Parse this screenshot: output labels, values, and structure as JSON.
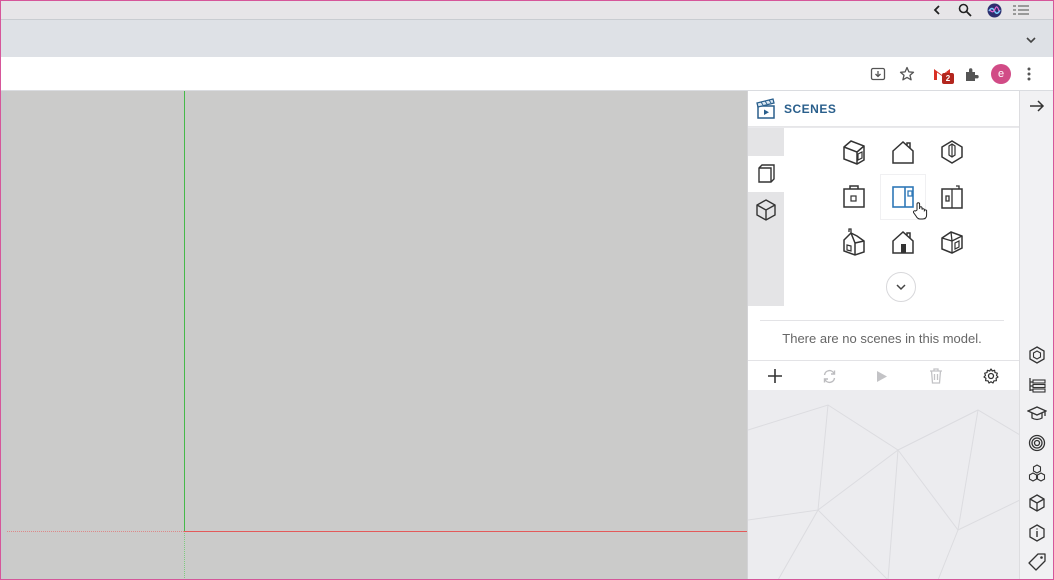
{
  "browser": {
    "toolbar_icons": [
      "install-icon",
      "star-icon",
      "gmail-icon",
      "extensions-icon",
      "kebab-menu-icon"
    ],
    "gmail_badge": "2",
    "profile_initial": "e"
  },
  "scenes_panel": {
    "title": "SCENES",
    "view_tabs": [
      "standard-views",
      "iso-views"
    ],
    "scene_icons": [
      "iso-house-icon",
      "front-house-icon",
      "perspective-house-icon",
      "top-view-icon",
      "side-view-icon",
      "right-view-icon",
      "iso-left-house-icon",
      "home-icon",
      "iso-right-house-icon"
    ],
    "empty_message": "There are no scenes in this model.",
    "actions": [
      "add-scene",
      "update-scene",
      "play-scenes",
      "delete-scene",
      "scene-settings"
    ]
  },
  "right_tray": {
    "items": [
      "close-panel",
      "styles",
      "outliner",
      "instructor",
      "materials",
      "components",
      "display",
      "entity-info",
      "tags"
    ]
  }
}
